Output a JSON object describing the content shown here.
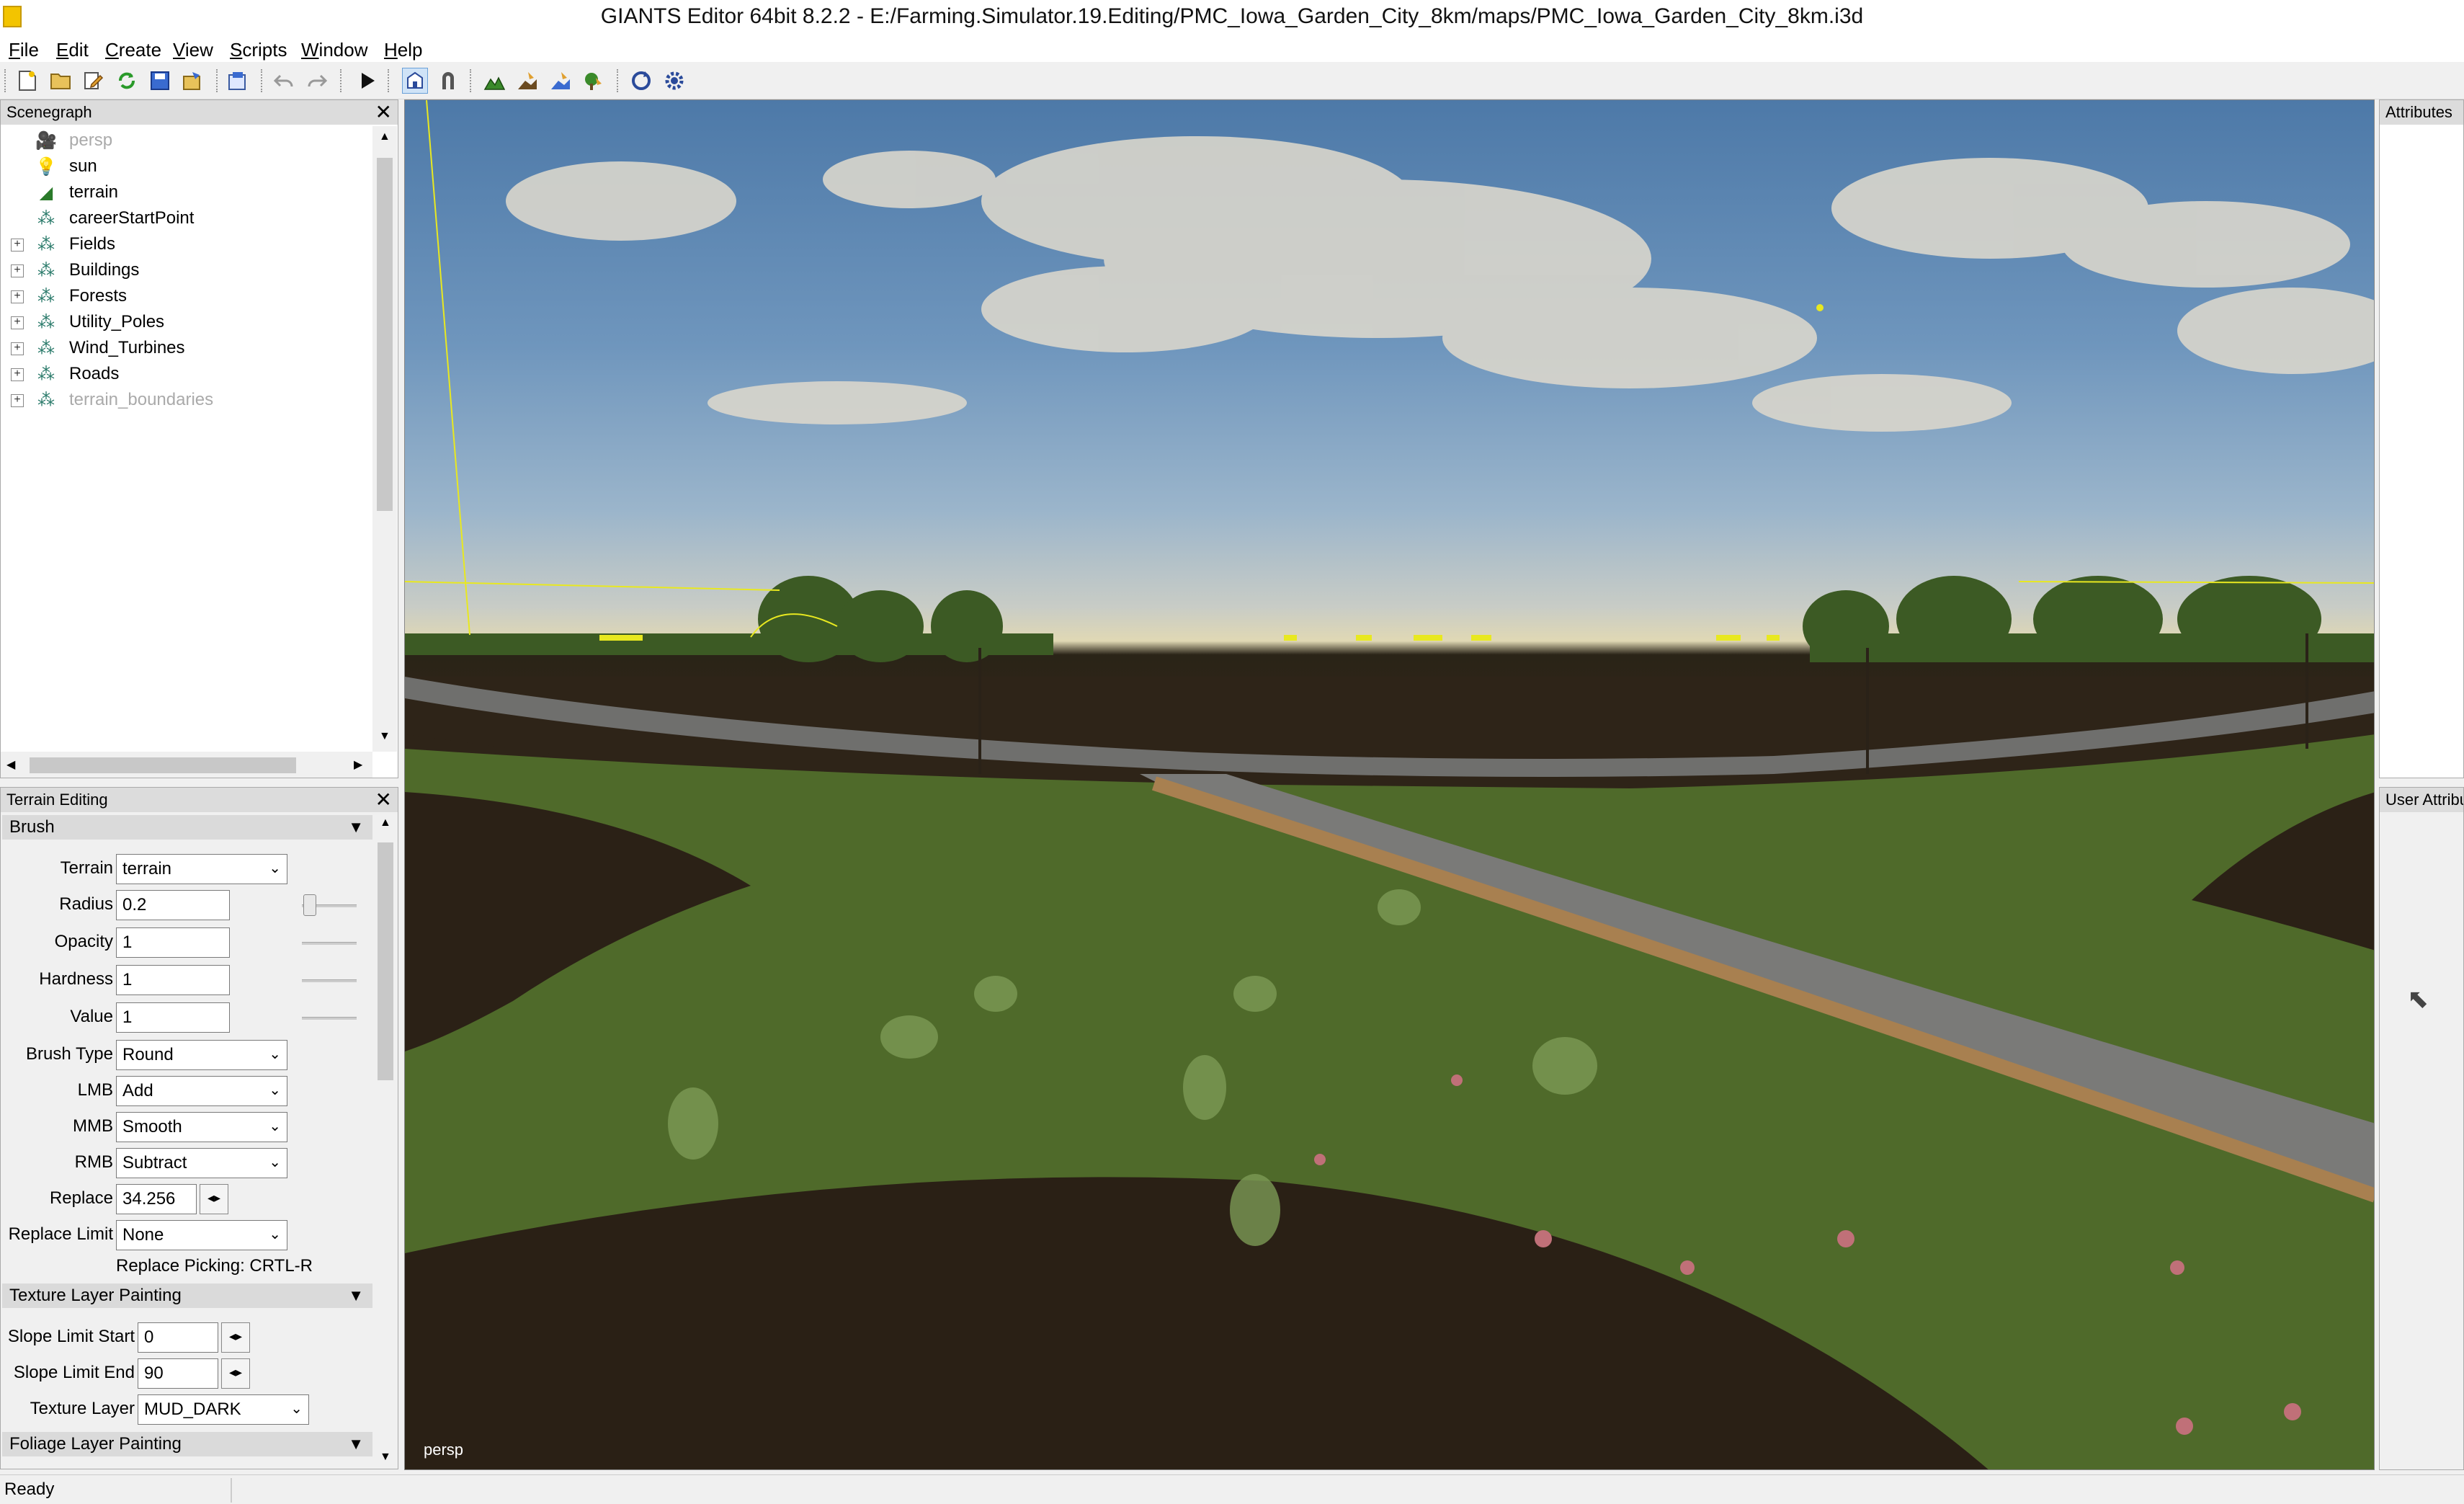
{
  "window": {
    "title": "GIANTS Editor 64bit 8.2.2 - E:/Farming.Simulator.19.Editing/PMC_Iowa_Garden_City_8km/maps/PMC_Iowa_Garden_City_8km.i3d"
  },
  "menu": [
    "File",
    "Edit",
    "Create",
    "View",
    "Scripts",
    "Window",
    "Help"
  ],
  "scenegraph": {
    "title": "Scenegraph",
    "close": "✕",
    "items": [
      {
        "label": "persp",
        "icon": "camera-icon",
        "glyph": "🎥",
        "expandable": false,
        "dim": true
      },
      {
        "label": "sun",
        "icon": "light-bulb-icon",
        "glyph": "💡",
        "expandable": false,
        "dim": false
      },
      {
        "label": "terrain",
        "icon": "terrain-icon",
        "glyph": "◢",
        "expandable": false,
        "dim": false
      },
      {
        "label": "careerStartPoint",
        "icon": "transform-group-icon",
        "glyph": "⁂",
        "expandable": false,
        "dim": false
      },
      {
        "label": "Fields",
        "icon": "transform-group-icon",
        "glyph": "⁂",
        "expandable": true,
        "dim": false
      },
      {
        "label": "Buildings",
        "icon": "transform-group-icon",
        "glyph": "⁂",
        "expandable": true,
        "dim": false
      },
      {
        "label": "Forests",
        "icon": "transform-group-icon",
        "glyph": "⁂",
        "expandable": true,
        "dim": false
      },
      {
        "label": "Utility_Poles",
        "icon": "transform-group-icon",
        "glyph": "⁂",
        "expandable": true,
        "dim": false
      },
      {
        "label": "Wind_Turbines",
        "icon": "transform-group-icon",
        "glyph": "⁂",
        "expandable": true,
        "dim": false
      },
      {
        "label": "Roads",
        "icon": "transform-group-icon",
        "glyph": "⁂",
        "expandable": true,
        "dim": false
      },
      {
        "label": "terrain_boundaries",
        "icon": "transform-group-icon",
        "glyph": "⁂",
        "expandable": true,
        "dim": true
      }
    ]
  },
  "terrain_editing": {
    "title": "Terrain Editing",
    "close": "✕",
    "brush": {
      "section": "Brush",
      "terrain_label": "Terrain",
      "terrain_value": "terrain",
      "radius_label": "Radius",
      "radius_value": "0.2",
      "opacity_label": "Opacity",
      "opacity_value": "1",
      "hardness_label": "Hardness",
      "hardness_value": "1",
      "value_label": "Value",
      "value_value": "1",
      "brush_type_label": "Brush Type",
      "brush_type_value": "Round",
      "lmb_label": "LMB",
      "lmb_value": "Add",
      "mmb_label": "MMB",
      "mmb_value": "Smooth",
      "rmb_label": "RMB",
      "rmb_value": "Subtract",
      "replace_label": "Replace",
      "replace_value": "34.256",
      "replace_limit_label": "Replace Limit",
      "replace_limit_value": "None",
      "replace_picking": "Replace Picking: CRTL-R"
    },
    "texture": {
      "section": "Texture Layer Painting",
      "slope_start_label": "Slope Limit Start",
      "slope_start_value": "0",
      "slope_end_label": "Slope Limit End",
      "slope_end_value": "90",
      "texture_layer_label": "Texture Layer",
      "texture_layer_value": "MUD_DARK"
    },
    "foliage": {
      "section": "Foliage Layer Painting"
    }
  },
  "viewport": {
    "camera_label": "persp"
  },
  "attributes": {
    "title": "Attributes"
  },
  "user_attributes": {
    "title": "User Attribu"
  },
  "status": {
    "text": "Ready"
  },
  "glyphs": {
    "arrow_down": "▼",
    "arrow_up": "▲",
    "arrow_left": "◀",
    "arrow_right": "▶",
    "chevron": "⌄",
    "stepper": "◂▸",
    "cursor": "⬉"
  }
}
